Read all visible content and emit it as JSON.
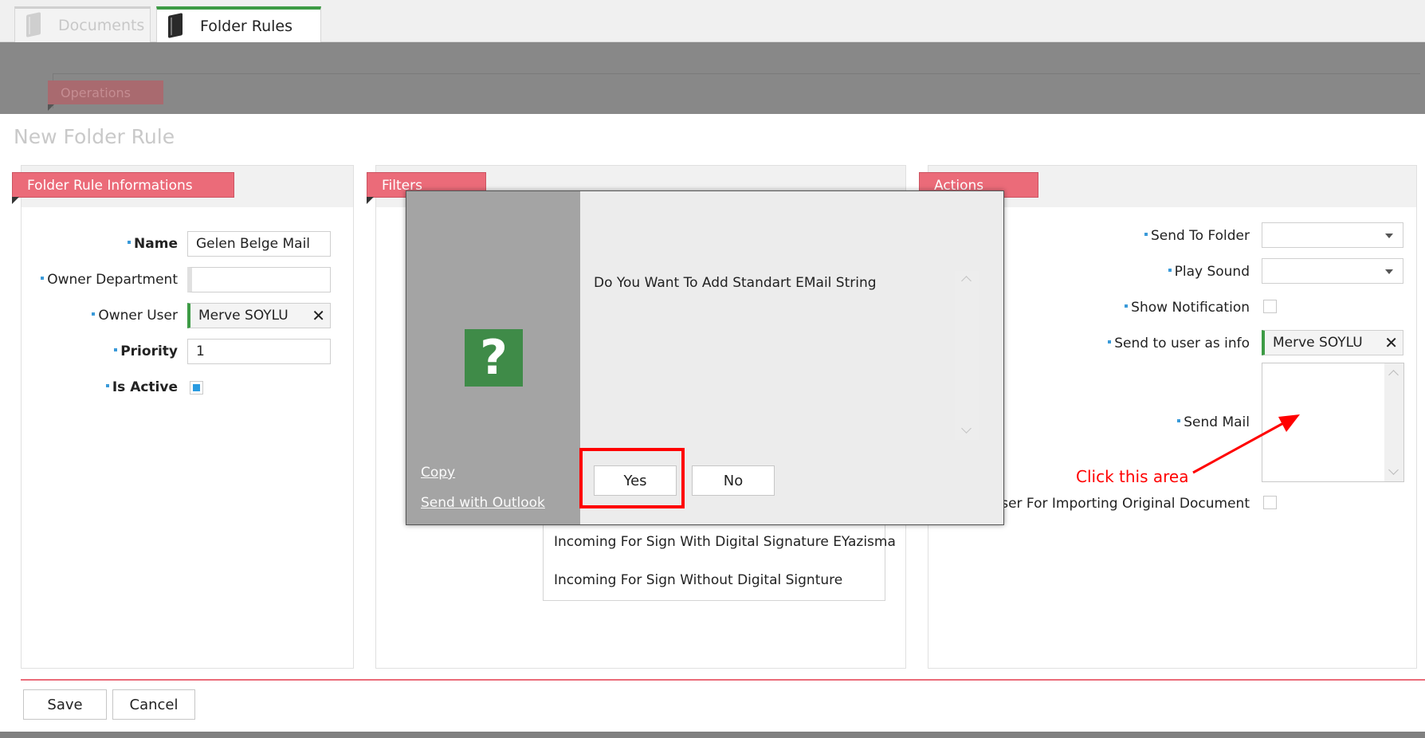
{
  "tabs": [
    {
      "label": "Documents",
      "icon": "book-icon",
      "active": false
    },
    {
      "label": "Folder Rules",
      "icon": "book-icon",
      "active": true
    }
  ],
  "operations_label": "Operations",
  "page_title": "New Folder Rule",
  "panels": {
    "info": {
      "title": "Folder Rule Informations",
      "fields": {
        "name": {
          "label": "Name",
          "value": "Gelen Belge Mail"
        },
        "owner_department": {
          "label": "Owner Department",
          "value": ""
        },
        "owner_user": {
          "label": "Owner User",
          "value": "Merve SOYLU"
        },
        "priority": {
          "label": "Priority",
          "value": "1"
        },
        "is_active": {
          "label": "Is Active",
          "checked": true
        }
      }
    },
    "filters": {
      "title": "Filters",
      "list_items": [
        "Incoming For Sign With Digital Signature EYazisma",
        "Incoming For Sign Without Digital Signture"
      ]
    },
    "actions": {
      "title": "Actions",
      "fields": {
        "send_to_folder": {
          "label": "Send To Folder",
          "value": ""
        },
        "play_sound": {
          "label": "Play Sound",
          "value": ""
        },
        "show_notification": {
          "label": "Show Notification",
          "checked": false
        },
        "send_to_user": {
          "label": "Send to user as info",
          "value": "Merve SOYLU"
        },
        "send_mail": {
          "label": "Send Mail",
          "value": ""
        },
        "importing_user": {
          "label": "User For Importing Original Document",
          "checked": false
        }
      }
    }
  },
  "buttons": {
    "save": "Save",
    "cancel": "Cancel"
  },
  "dialog": {
    "message": "Do You Want To Add Standart EMail String",
    "icon": "question-icon",
    "copy_link": "Copy",
    "outlook_link": "Send with Outlook",
    "yes": "Yes",
    "no": "No"
  },
  "annotation": {
    "text": "Click this area",
    "color": "#ff0000"
  },
  "colors": {
    "accent_green": "#3d9b45",
    "tag_red": "#eb6b79",
    "check_blue": "#2a9be0"
  }
}
